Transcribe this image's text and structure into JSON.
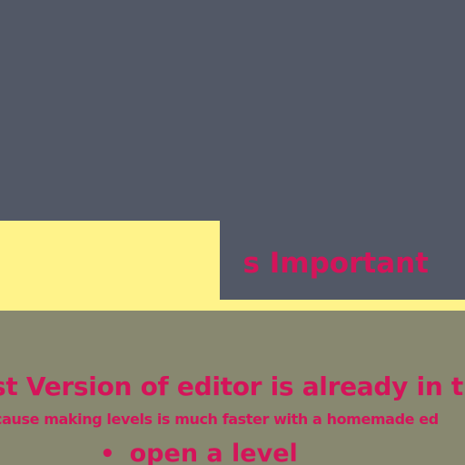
{
  "colors": {
    "background": "#525866",
    "highlight_card": "#fff38a",
    "content_panel": "#888870",
    "accent_text": "#d4145a"
  },
  "heading": {
    "text": "s Important"
  },
  "content": {
    "line_1": "st Version of editor is already in th",
    "line_2": "cause making levels is much faster with a homemade ed",
    "bullets": [
      {
        "marker": "•",
        "text": "open a level"
      }
    ]
  }
}
